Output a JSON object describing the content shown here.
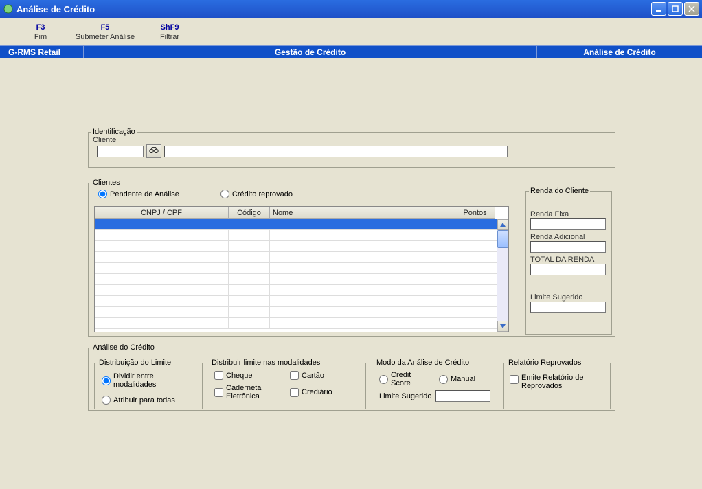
{
  "window": {
    "title": "Análise de Crédito"
  },
  "shortcuts": [
    {
      "key": "F3",
      "label": "Fim"
    },
    {
      "key": "F5",
      "label": "Submeter Análise"
    },
    {
      "key": "ShF9",
      "label": "Filtrar"
    }
  ],
  "navbar": {
    "left": "G-RMS Retail",
    "center": "Gestão de Crédito",
    "right": "Análise de Crédito"
  },
  "identificacao": {
    "legend": "Identificação",
    "cliente_label": "Cliente",
    "cliente_code": "",
    "cliente_name": ""
  },
  "clientes": {
    "legend": "Clientes",
    "radio_pendente": "Pendente de Análise",
    "radio_reprovado": "Crédito reprovado",
    "columns": {
      "cnpj": "CNPJ / CPF",
      "codigo": "Código",
      "nome": "Nome",
      "pontos": "Pontos"
    }
  },
  "renda": {
    "legend": "Renda do Cliente",
    "fixa_label": "Renda Fixa",
    "adicional_label": "Renda Adicional",
    "total_label": "TOTAL DA RENDA",
    "limite_label": "Limite Sugerido",
    "fixa": "",
    "adicional": "",
    "total": "",
    "limite": ""
  },
  "analise": {
    "legend": "Análise do Crédito",
    "dist": {
      "legend": "Distribuição do Limite",
      "opt1": "Dividir entre modalidades",
      "opt2": "Atribuir para todas"
    },
    "mod": {
      "legend": "Distribuir limite nas modalidades",
      "cheque": "Cheque",
      "cartao": "Cartão",
      "caderneta": "Caderneta Eletrônica",
      "crediario": "Crediário"
    },
    "modo": {
      "legend": "Modo da Análise de Crédito",
      "credit_score": "Credit Score",
      "manual": "Manual",
      "limite_label": "Limite Sugerido",
      "limite": ""
    },
    "rel": {
      "legend": "Relatório Reprovados",
      "emite": "Emite Relatório de Reprovados"
    }
  }
}
